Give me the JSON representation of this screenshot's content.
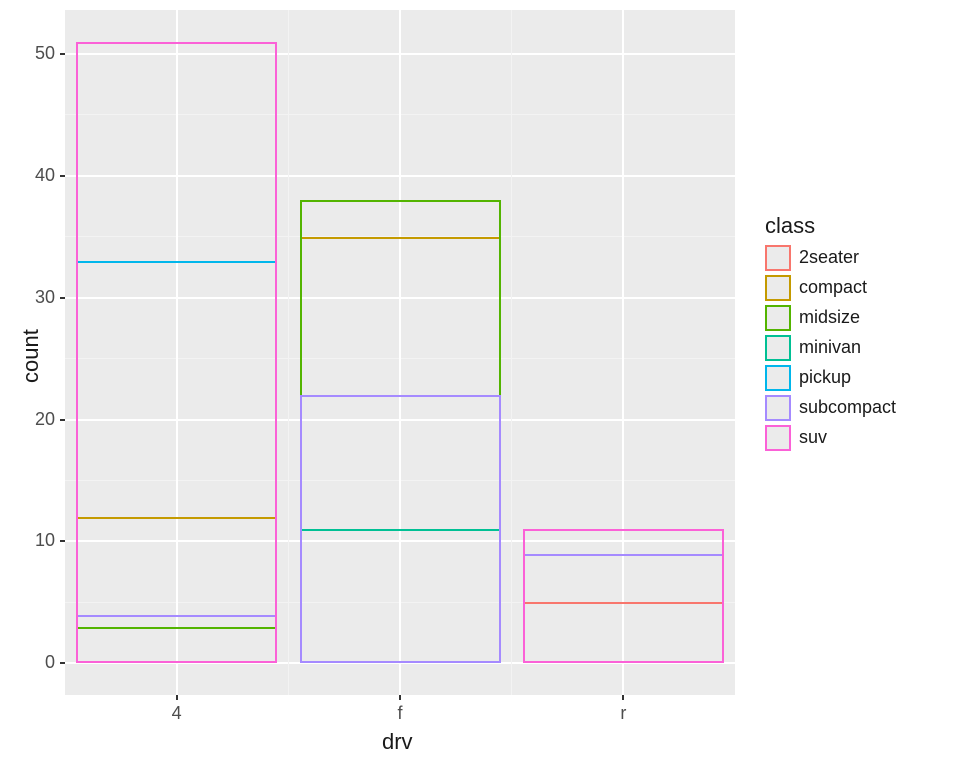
{
  "chart_data": {
    "type": "bar",
    "identity_position_overlaid": true,
    "categories": [
      "4",
      "f",
      "r"
    ],
    "series": [
      {
        "name": "2seater",
        "values": [
          0,
          0,
          5
        ]
      },
      {
        "name": "compact",
        "values": [
          12,
          35,
          0
        ]
      },
      {
        "name": "midsize",
        "values": [
          3,
          38,
          0
        ]
      },
      {
        "name": "minivan",
        "values": [
          0,
          11,
          0
        ]
      },
      {
        "name": "pickup",
        "values": [
          33,
          0,
          0
        ]
      },
      {
        "name": "subcompact",
        "values": [
          4,
          22,
          9
        ]
      },
      {
        "name": "suv",
        "values": [
          51,
          0,
          11
        ]
      }
    ],
    "xlabel": "drv",
    "ylabel": "count",
    "ylim": [
      0,
      51
    ],
    "y_ticks": [
      0,
      10,
      20,
      30,
      40,
      50
    ],
    "legend_title": "class",
    "legend_position": "right",
    "colors": {
      "2seater": "#F8766D",
      "compact": "#C49A00",
      "midsize": "#53B400",
      "minivan": "#00C094",
      "pickup": "#00B6EB",
      "subcompact": "#A58AFF",
      "suv": "#FB61D7"
    }
  },
  "legend": {
    "title": "class",
    "items": [
      {
        "label": "2seater",
        "color": "#F8766D"
      },
      {
        "label": "compact",
        "color": "#C49A00"
      },
      {
        "label": "midsize",
        "color": "#53B400"
      },
      {
        "label": "minivan",
        "color": "#00C094"
      },
      {
        "label": "pickup",
        "color": "#00B6EB"
      },
      {
        "label": "subcompact",
        "color": "#A58AFF"
      },
      {
        "label": "suv",
        "color": "#FB61D7"
      }
    ]
  },
  "axes": {
    "x": {
      "title": "drv",
      "ticks": [
        "4",
        "f",
        "r"
      ]
    },
    "y": {
      "title": "count",
      "ticks": [
        "0",
        "10",
        "20",
        "30",
        "40",
        "50"
      ]
    }
  }
}
